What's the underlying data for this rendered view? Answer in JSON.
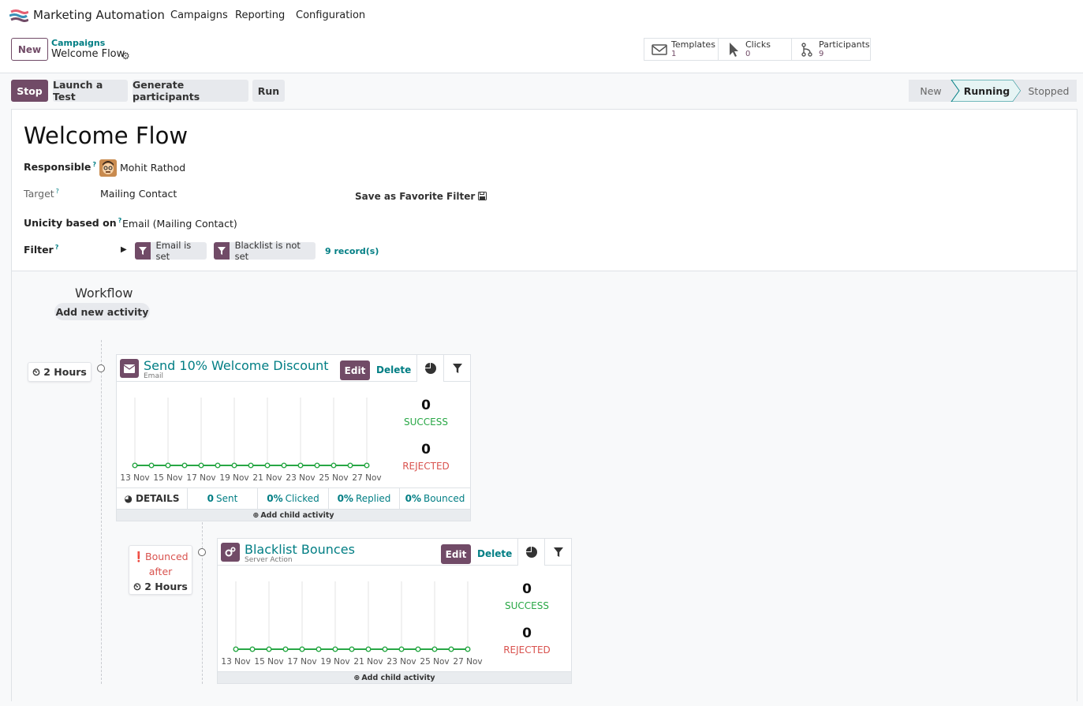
{
  "app": {
    "title": "Marketing Automation",
    "menu": [
      "Campaigns",
      "Reporting",
      "Configuration"
    ]
  },
  "control": {
    "new_label": "New",
    "breadcrumb_parent": "Campaigns",
    "breadcrumb_current": "Welcome Flow",
    "stats": [
      {
        "label": "Templates",
        "value": "1",
        "icon": "envelope-icon"
      },
      {
        "label": "Clicks",
        "value": "0",
        "icon": "cursor-icon"
      },
      {
        "label": "Participants",
        "value": "9",
        "icon": "fork-icon"
      }
    ]
  },
  "actions": {
    "stop": "Stop",
    "launch_test": "Launch a Test",
    "generate": "Generate participants",
    "run": "Run"
  },
  "statusbar": {
    "stages": [
      "New",
      "Running",
      "Stopped"
    ],
    "current": "Running"
  },
  "form": {
    "title": "Welcome Flow",
    "responsible_label": "Responsible",
    "responsible_value": "Mohit Rathod",
    "target_label": "Target",
    "target_value": "Mailing Contact",
    "save_favorite": "Save as Favorite Filter",
    "unicity_label": "Unicity based on",
    "unicity_value": "Email (Mailing Contact)",
    "filter_label": "Filter",
    "help_mark": "?",
    "filter_chips": [
      "Email is set",
      "Blacklist is not set"
    ],
    "records": "9 record(s)"
  },
  "workflow": {
    "title": "Workflow",
    "add_activity": "Add new activity",
    "x_labels": [
      "13 Nov",
      "15 Nov",
      "17 Nov",
      "19 Nov",
      "21 Nov",
      "23 Nov",
      "25 Nov",
      "27 Nov"
    ],
    "activities": [
      {
        "trigger": "2 Hours",
        "title": "Send 10% Welcome Discount",
        "type": "Email",
        "edit": "Edit",
        "delete": "Delete",
        "success_count": "0",
        "success_label": "SUCCESS",
        "rejected_count": "0",
        "rejected_label": "REJECTED",
        "details_label": "DETAILS",
        "footer": {
          "sent": "0",
          "sent_label": "Sent",
          "clicked": "0%",
          "clicked_label": "Clicked",
          "replied": "0%",
          "replied_label": "Replied",
          "bounced": "0%",
          "bounced_label": "Bounced"
        },
        "add_child": "Add child activity",
        "chart_data": {
          "type": "line",
          "x": [
            "13 Nov",
            "14 Nov",
            "15 Nov",
            "16 Nov",
            "17 Nov",
            "18 Nov",
            "19 Nov",
            "20 Nov",
            "21 Nov",
            "22 Nov",
            "23 Nov",
            "24 Nov",
            "25 Nov",
            "26 Nov",
            "27 Nov"
          ],
          "series": [
            {
              "values": [
                0,
                0,
                0,
                0,
                0,
                0,
                0,
                0,
                0,
                0,
                0,
                0,
                0,
                0,
                0
              ]
            }
          ],
          "color": "#28a745"
        }
      },
      {
        "trigger_event": "Bounced",
        "trigger_after": "after",
        "trigger": "2 Hours",
        "title": "Blacklist Bounces",
        "type": "Server Action",
        "edit": "Edit",
        "delete": "Delete",
        "success_count": "0",
        "success_label": "SUCCESS",
        "rejected_count": "0",
        "rejected_label": "REJECTED",
        "add_child": "Add child activity",
        "chart_data": {
          "type": "line",
          "x": [
            "13 Nov",
            "14 Nov",
            "15 Nov",
            "16 Nov",
            "17 Nov",
            "18 Nov",
            "19 Nov",
            "20 Nov",
            "21 Nov",
            "22 Nov",
            "23 Nov",
            "24 Nov",
            "25 Nov",
            "26 Nov",
            "27 Nov"
          ],
          "series": [
            {
              "values": [
                0,
                0,
                0,
                0,
                0,
                0,
                0,
                0,
                0,
                0,
                0,
                0,
                0,
                0,
                0
              ]
            }
          ],
          "color": "#28a745"
        }
      }
    ]
  },
  "colors": {
    "primary": "#714b67",
    "link": "#017e84",
    "success": "#28a745",
    "danger": "#d9534f"
  }
}
